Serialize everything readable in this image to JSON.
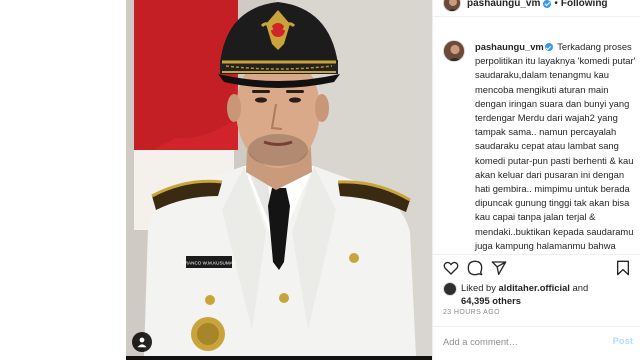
{
  "header": {
    "username": "pashaungu_vm",
    "separator": "•",
    "follow_label": "Following"
  },
  "photo": {
    "name_tag": "FRANCO W.M.KUSUMAH",
    "user_tag_icon": "person-icon"
  },
  "caption": {
    "username": "pashaungu_vm",
    "text": "Terkadang proses perpolitikan itu layaknya 'komedi putar' saudaraku,dalam tenangmu kau mencoba mengikuti aturan main dengan iringan suara dan bunyi yang terdengar Merdu dari wajah2 yang tampak sama.. namun percayalah saudaraku cepat atau lambat sang komedi putar-pun pasti berhenti & kau akan keluar dari pusaran ini dengan hati gembira.. mimpimu untuk berada dipuncak gunung tinggi tak akan bisa kau capai tanpa jalan terjal & mendaki..buktikan kepada saudaramu juga kampung halamanmu bahwa akan tiba saatnya keringatmu akan memiliki arti besar & punya nilai dalam pengabdianmu terhadap bangsa tercinta ini.. izinkan saya"
  },
  "actions": {
    "like_icon": "heart-icon",
    "comment_icon": "comment-icon",
    "share_icon": "share-icon",
    "save_icon": "bookmark-icon"
  },
  "likes": {
    "prefix": "Liked by",
    "user": "alditaher.official",
    "middle": "and",
    "count": "64,395 others"
  },
  "timestamp": "23 HOURS AGO",
  "comment": {
    "placeholder": "Add a comment…",
    "post_label": "Post"
  },
  "colors": {
    "verified": "#3897f0",
    "post_disabled": "#b2dffc",
    "flag_red": "#d1232a"
  }
}
